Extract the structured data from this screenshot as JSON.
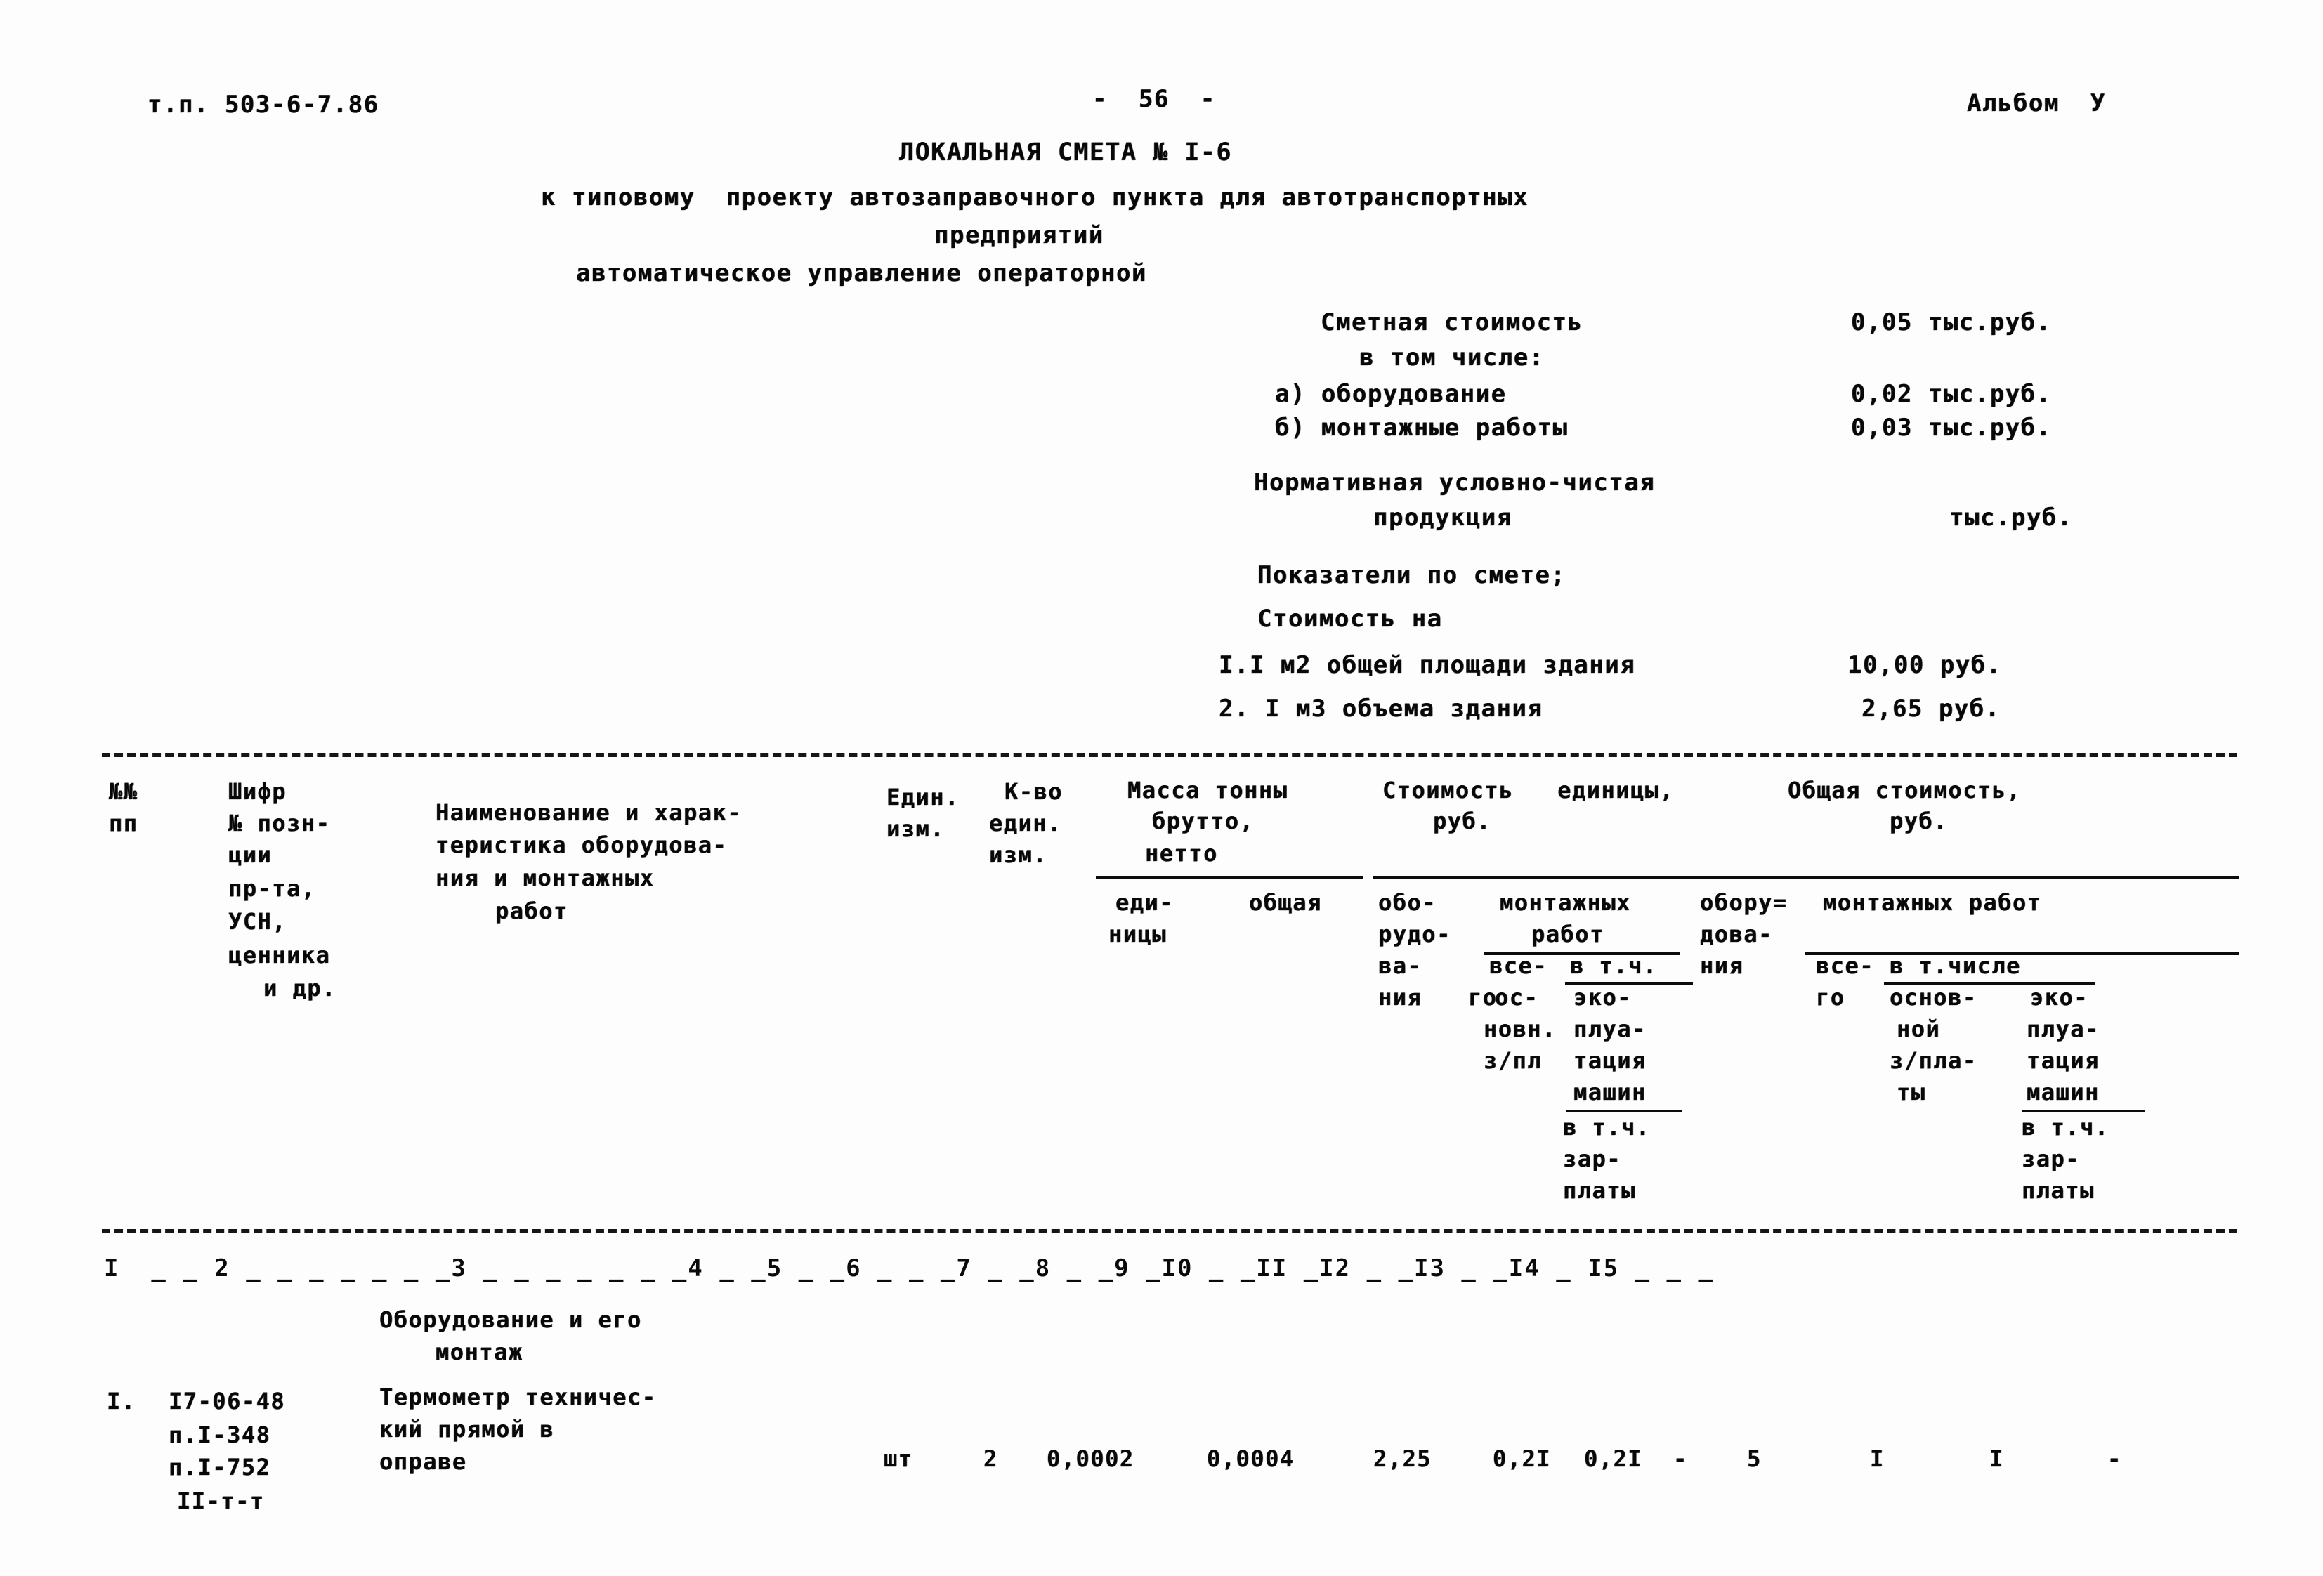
{
  "header": {
    "doc_code": "т.п. 503-6-7.86",
    "page_marker": "-  56  -",
    "album": "Альбом  У"
  },
  "title": {
    "line1": "ЛОКАЛЬНАЯ СМЕТА № I-6",
    "line2": "к типовому  проекту автозаправочного пункта для автотранспортных",
    "line3": "предприятий",
    "line4": "автоматическое управление операторной"
  },
  "summary": {
    "cost_label": "Сметная стоимость",
    "cost_value": "0,05 тыс.руб.",
    "including_label": "в том числе:",
    "item_a_label": "а) оборудование",
    "item_a_value": "0,02 тыс.руб.",
    "item_b_label": "б) монтажные работы",
    "item_b_value": "0,03 тыс.руб.",
    "nucp_label_1": "Нормативная условно-чистая",
    "nucp_label_2": "продукция",
    "nucp_value": "тыс.руб.",
    "indicators_label": "Показатели по смете;",
    "cost_per_label": "Стоимость на",
    "per_m2_label": "I.I м2 общей площади здания",
    "per_m2_value": "10,00 руб.",
    "per_m3_label": "2. I м3 объема здания",
    "per_m3_value": "2,65 руб."
  },
  "table": {
    "headers": {
      "col1_l1": "№№",
      "col1_l2": "пп",
      "col2_l1": "Шифр",
      "col2_l2": "№ позн-",
      "col2_l3": "ции",
      "col2_l4": "пр-та,",
      "col2_l5": "УСН,",
      "col2_l6": "ценника",
      "col2_l7": "и др.",
      "col3_l1": "Наименование и харак-",
      "col3_l2": "теристика оборудова-",
      "col3_l3": "ния и монтажных",
      "col3_l4": "работ",
      "col4_l1": "Един.",
      "col4_l2": "изм.",
      "col5_l1": "К-во",
      "col5_l2": "един.",
      "col5_l3": "изм.",
      "mass_l1": "Масса тонны",
      "mass_l2": "брутто,",
      "mass_l3": "нетто",
      "mass_sub1": "еди-",
      "mass_sub1b": "ницы",
      "mass_sub2": "общая",
      "unitcost_l1": "Стоимость   единицы,",
      "unitcost_l2": "руб.",
      "uc_equip_l1": "обо-",
      "uc_equip_l2": "рудо-",
      "uc_equip_l3": "ва-",
      "uc_equip_l4": "ния",
      "uc_mont_title": "монтажных",
      "uc_mont_rabot": "работ",
      "uc_mont_vtch": "в т.ч.",
      "uc_mont_vsego_1": "все-",
      "uc_mont_vsego_2": "го",
      "uc_mont_osn_1": "ос-",
      "uc_mont_osn_2": "новн.",
      "uc_mont_osn_3": "з/пл",
      "uc_mont_eks_1": "эко-",
      "uc_mont_eks_2": "плуа-",
      "uc_mont_eks_3": "тация",
      "uc_mont_eks_4": "машин",
      "uc_mont_zp_1": "в т.ч.",
      "uc_mont_zp_2": "зар-",
      "uc_mont_zp_3": "платы",
      "totalcost_l1": "Общая стоимость,",
      "totalcost_l2": "руб.",
      "tc_equip_l1": "обору=",
      "tc_equip_l2": "дова-",
      "tc_equip_l3": "ния",
      "tc_mont_title": "монтажных работ",
      "tc_mont_vsego_1": "все-",
      "tc_mont_vsego_2": "го",
      "tc_mont_vtch": "в т.числе",
      "tc_mont_osn_1": "основ-",
      "tc_mont_osn_2": "ной",
      "tc_mont_osn_3": "з/пла-",
      "tc_mont_osn_4": "ты",
      "tc_mont_eks_1": "эко-",
      "tc_mont_eks_2": "плуа-",
      "tc_mont_eks_3": "тация",
      "tc_mont_eks_4": "машин",
      "tc_mont_zp_1": "в т.ч.",
      "tc_mont_zp_2": "зар-",
      "tc_mont_zp_3": "платы"
    },
    "column_numbers": "I  _ _ 2 _ _ _ _ _ _ _3 _ _ _ _ _ _ _4 _ _5 _ _6 _ _ _7 _ _8 _ _9 _I0 _ _II _I2 _ _I3 _ _I4 _ I5 _ _ _",
    "section_title_l1": "Оборудование и его",
    "section_title_l2": "монтаж",
    "rows": [
      {
        "num": "I.",
        "code_l1": "I7-06-48",
        "code_l2": "п.I-348",
        "code_l3": "п.I-752",
        "code_l4": "II-т-т",
        "name_l1": "Термометр техничес-",
        "name_l2": "кий прямой в",
        "name_l3": "оправе",
        "unit": "шт",
        "qty": "2",
        "mass_unit": "0,0002",
        "mass_total": "0,0004",
        "uc_equip": "2,25",
        "uc_mont_total": "0,2I",
        "uc_mont_osn": "0,2I",
        "uc_mont_eks": "-",
        "tc_equip": "5",
        "tc_mont_total": "I",
        "tc_mont_osn": "I",
        "tc_mont_eks": "-"
      }
    ]
  }
}
